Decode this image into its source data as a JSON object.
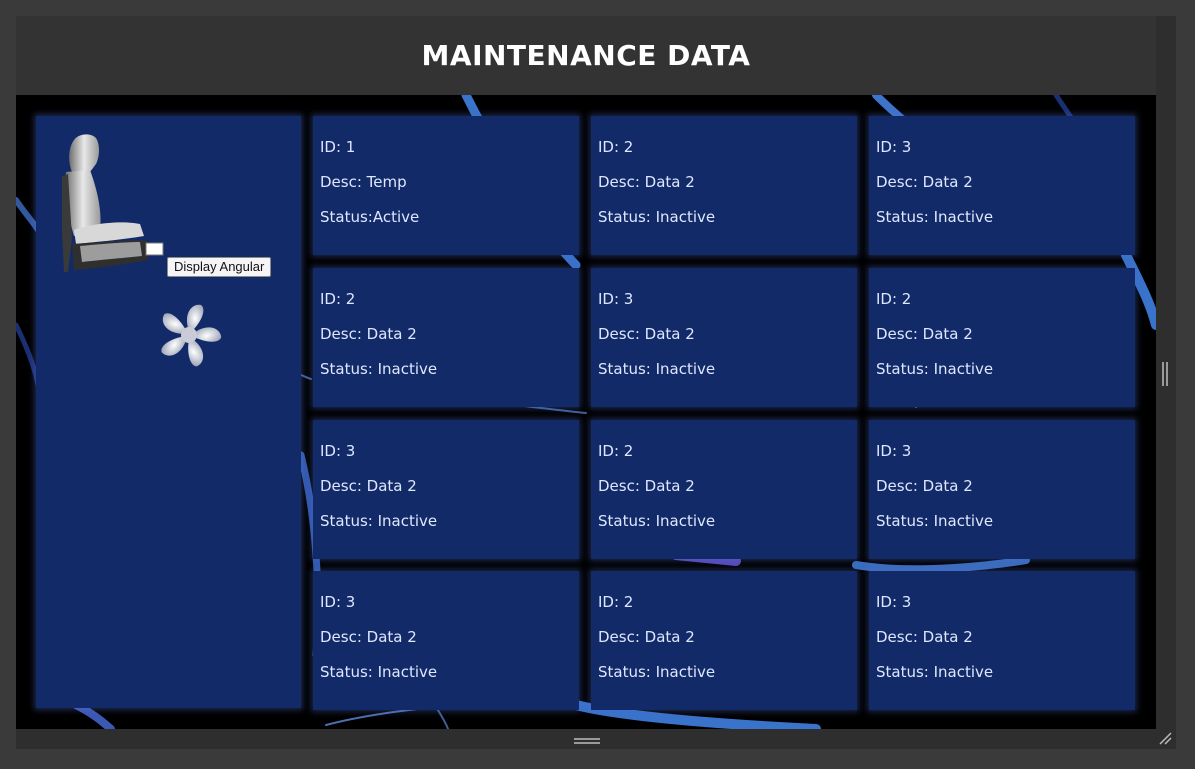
{
  "page": {
    "title": "MAINTENANCE DATA"
  },
  "left_panel": {
    "seat_icon": "aircraft-seat-icon",
    "fan_icon": "fan-icon",
    "button_label": "Display Angular"
  },
  "cards": [
    {
      "id": "ID: 1",
      "desc": "Desc: Temp",
      "status": "Status:Active"
    },
    {
      "id": "ID: 2",
      "desc": "Desc: Data 2",
      "status": "Status: Inactive"
    },
    {
      "id": "ID: 3",
      "desc": "Desc: Data 2",
      "status": "Status: Inactive"
    },
    {
      "id": "ID: 2",
      "desc": "Desc: Data 2",
      "status": "Status: Inactive"
    },
    {
      "id": "ID: 3",
      "desc": "Desc: Data 2",
      "status": "Status: Inactive"
    },
    {
      "id": "ID: 2",
      "desc": "Desc: Data 2",
      "status": "Status: Inactive"
    },
    {
      "id": "ID: 3",
      "desc": "Desc: Data 2",
      "status": "Status: Inactive"
    },
    {
      "id": "ID: 2",
      "desc": "Desc: Data 2",
      "status": "Status: Inactive"
    },
    {
      "id": "ID: 3",
      "desc": "Desc: Data 2",
      "status": "Status: Inactive"
    },
    {
      "id": "ID: 3",
      "desc": "Desc: Data 2",
      "status": "Status: Inactive"
    },
    {
      "id": "ID: 2",
      "desc": "Desc: Data 2",
      "status": "Status: Inactive"
    },
    {
      "id": "ID: 3",
      "desc": "Desc: Data 2",
      "status": "Status: Inactive"
    }
  ],
  "colors": {
    "card_bg": "#122a67",
    "header_bg": "#333333",
    "stage_bg": "#000000",
    "accent_ribbon": "#3f7fe0"
  }
}
